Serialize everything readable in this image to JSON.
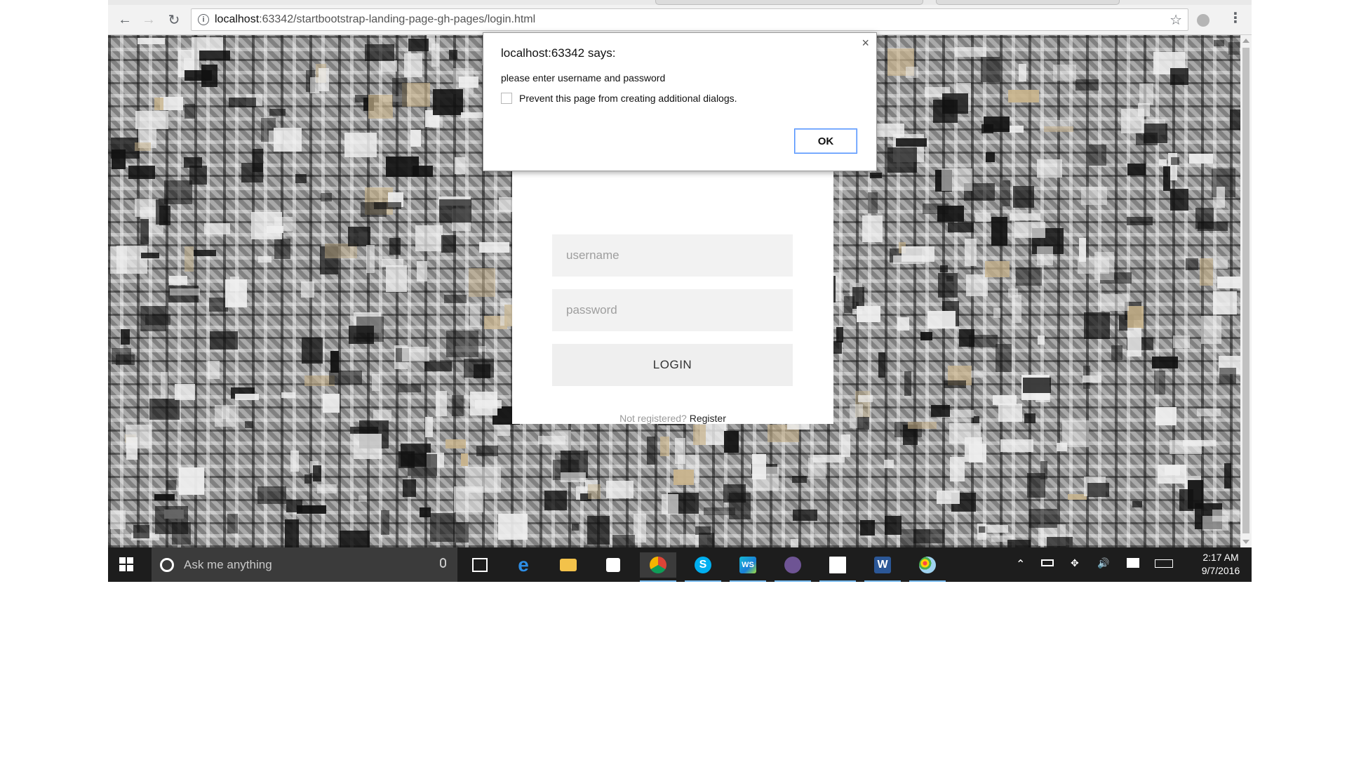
{
  "browser": {
    "url_host": "localhost",
    "url_rest": ":63342/startbootstrap-landing-page-gh-pages/login.html"
  },
  "dialog": {
    "title": "localhost:63342 says:",
    "message": "please enter username and password",
    "checkbox_label": "Prevent this page from creating additional dialogs.",
    "ok_label": "OK",
    "close_glyph": "×"
  },
  "login": {
    "username_placeholder": "username",
    "password_placeholder": "password",
    "login_label": "LOGIN",
    "not_registered_text": "Not registered?",
    "register_link": "Register"
  },
  "taskbar": {
    "search_placeholder": "Ask me anything",
    "time": "2:17 AM",
    "date": "9/7/2016",
    "apps": [
      "task-view",
      "edge",
      "file-explorer",
      "store",
      "chrome",
      "skype",
      "webstorm",
      "github",
      "photos",
      "word",
      "paint"
    ]
  },
  "colors": {
    "taskbar": "#1d1d1d",
    "accent_underline": "#76b9ed",
    "dialog_ok_border": "#4d90fe"
  }
}
